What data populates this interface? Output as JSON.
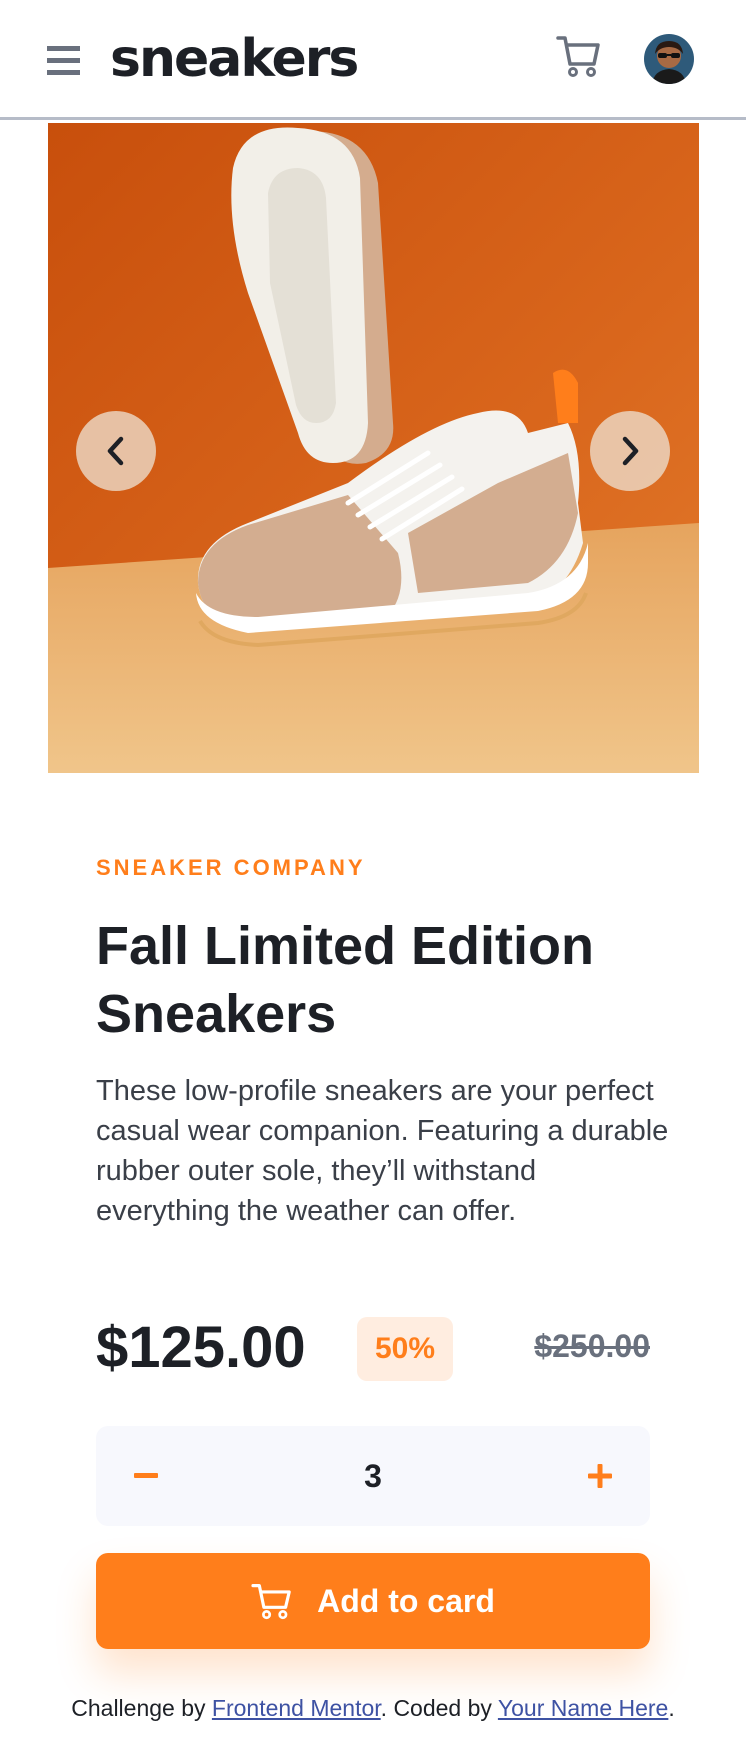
{
  "header": {
    "logo": "sneakers",
    "menu_icon": "hamburger-menu-icon",
    "cart_icon": "cart-icon",
    "avatar_icon": "user-avatar"
  },
  "gallery": {
    "image_icon": "sneaker-product-photo",
    "prev_icon": "chevron-left-icon",
    "next_icon": "chevron-right-icon"
  },
  "product": {
    "brand": "SNEAKER COMPANY",
    "title_line1": "Fall Limited Edition",
    "title_line2": "Sneakers",
    "description": "These low-profile sneakers are your perfect casual wear companion. Featuring a durable rubber outer sole, they’ll withstand everything the weather can offer.",
    "price": "$125.00",
    "discount": "50%",
    "original_price": "$250.00"
  },
  "quantity": {
    "value": "3",
    "minus_icon": "minus-icon",
    "plus_icon": "plus-icon"
  },
  "add_to_cart": {
    "label": "Add to card",
    "icon": "cart-icon"
  },
  "attribution": {
    "prefix": "Challenge by ",
    "link1": "Frontend Mentor",
    "middle": ". Coded by ",
    "link2": "Your Name Here",
    "suffix": "."
  },
  "colors": {
    "accent": "#ff7e1b",
    "accent_pale": "#ffede0",
    "dark": "#1d2026",
    "gray": "#69707d",
    "light_bg": "#f7f8fd"
  }
}
